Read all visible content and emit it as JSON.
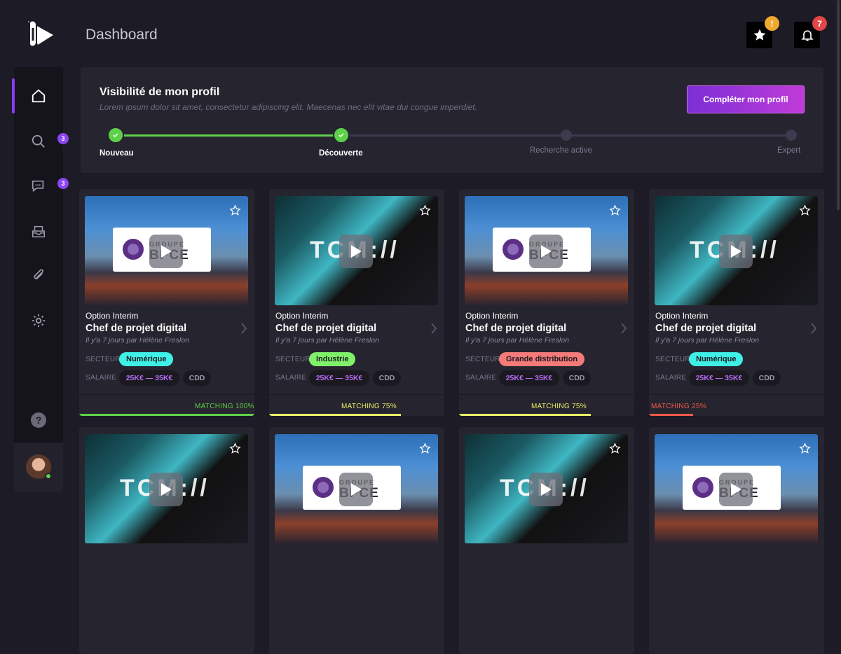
{
  "header": {
    "title": "Dashboard",
    "favorites_badge": "!",
    "notifications_badge": "7"
  },
  "sidebar": {
    "items": [
      {
        "name": "home",
        "icon": "home-icon",
        "active": true
      },
      {
        "name": "search",
        "icon": "search-icon",
        "badge": "3"
      },
      {
        "name": "messages",
        "icon": "chat-icon",
        "badge": "3"
      },
      {
        "name": "mailbox",
        "icon": "inbox-icon"
      },
      {
        "name": "attachments",
        "icon": "paperclip-icon"
      },
      {
        "name": "settings",
        "icon": "gear-icon"
      }
    ],
    "help_icon": "help-icon",
    "avatar_status": "online"
  },
  "profile": {
    "title": "Visibilité de mon profil",
    "subtitle": "Lorem ipsum dolor sit amet, consectetur adipiscing elit. Maecenas nec elit vitae dui congue imperdiet.",
    "cta": "Compléter mon profil",
    "steps": [
      {
        "label": "Nouveau",
        "done": true
      },
      {
        "label": "Découverte",
        "done": true
      },
      {
        "label": "Recherche active",
        "done": false
      },
      {
        "label": "Expert",
        "done": false
      }
    ]
  },
  "labels": {
    "sector": "SECTEUR",
    "salary": "SALAIRE",
    "matching": "MATCHING"
  },
  "cards": [
    {
      "image": "building",
      "company": "Option Interim",
      "title": "Chef de projet digital",
      "meta": "Il y'a 7 jours par Hélène Freslon",
      "sector": "Numérique",
      "sector_color": "#3ff0e6",
      "salary": "25K€ — 35K€",
      "contract": "CDD",
      "matching": "100%",
      "matching_value": 100,
      "matching_color": "#5ed14a"
    },
    {
      "image": "tech",
      "company": "Option Interim",
      "title": "Chef de projet digital",
      "meta": "Il y'a 7 jours par Hélène Freslon",
      "sector": "Industrie",
      "sector_color": "#7ff06a",
      "salary": "25K€ — 35K€",
      "contract": "CDD",
      "matching": "75%",
      "matching_value": 75,
      "matching_color": "#e9f06a"
    },
    {
      "image": "building",
      "company": "Option Interim",
      "title": "Chef de projet digital",
      "meta": "Il y'a 7 jours par Hélène Freslon",
      "sector": "Grande distribution",
      "sector_color": "#f57a7a",
      "salary": "25K€ — 35K€",
      "contract": "CDD",
      "matching": "75%",
      "matching_value": 75,
      "matching_color": "#e9f06a"
    },
    {
      "image": "tech",
      "company": "Option Interim",
      "title": "Chef de projet digital",
      "meta": "Il y'a 7 jours par Hélène Freslon",
      "sector": "Numérique",
      "sector_color": "#3ff0e6",
      "salary": "25K€ — 35K€",
      "contract": "CDD",
      "matching": "25%",
      "matching_value": 25,
      "matching_color": "#f05a4a"
    },
    {
      "image": "tech"
    },
    {
      "image": "building"
    },
    {
      "image": "tech"
    },
    {
      "image": "building"
    }
  ],
  "logos": {
    "bpce_small": "GROUPE",
    "bpce_big": "BPCE",
    "tcm": "TCM://"
  }
}
